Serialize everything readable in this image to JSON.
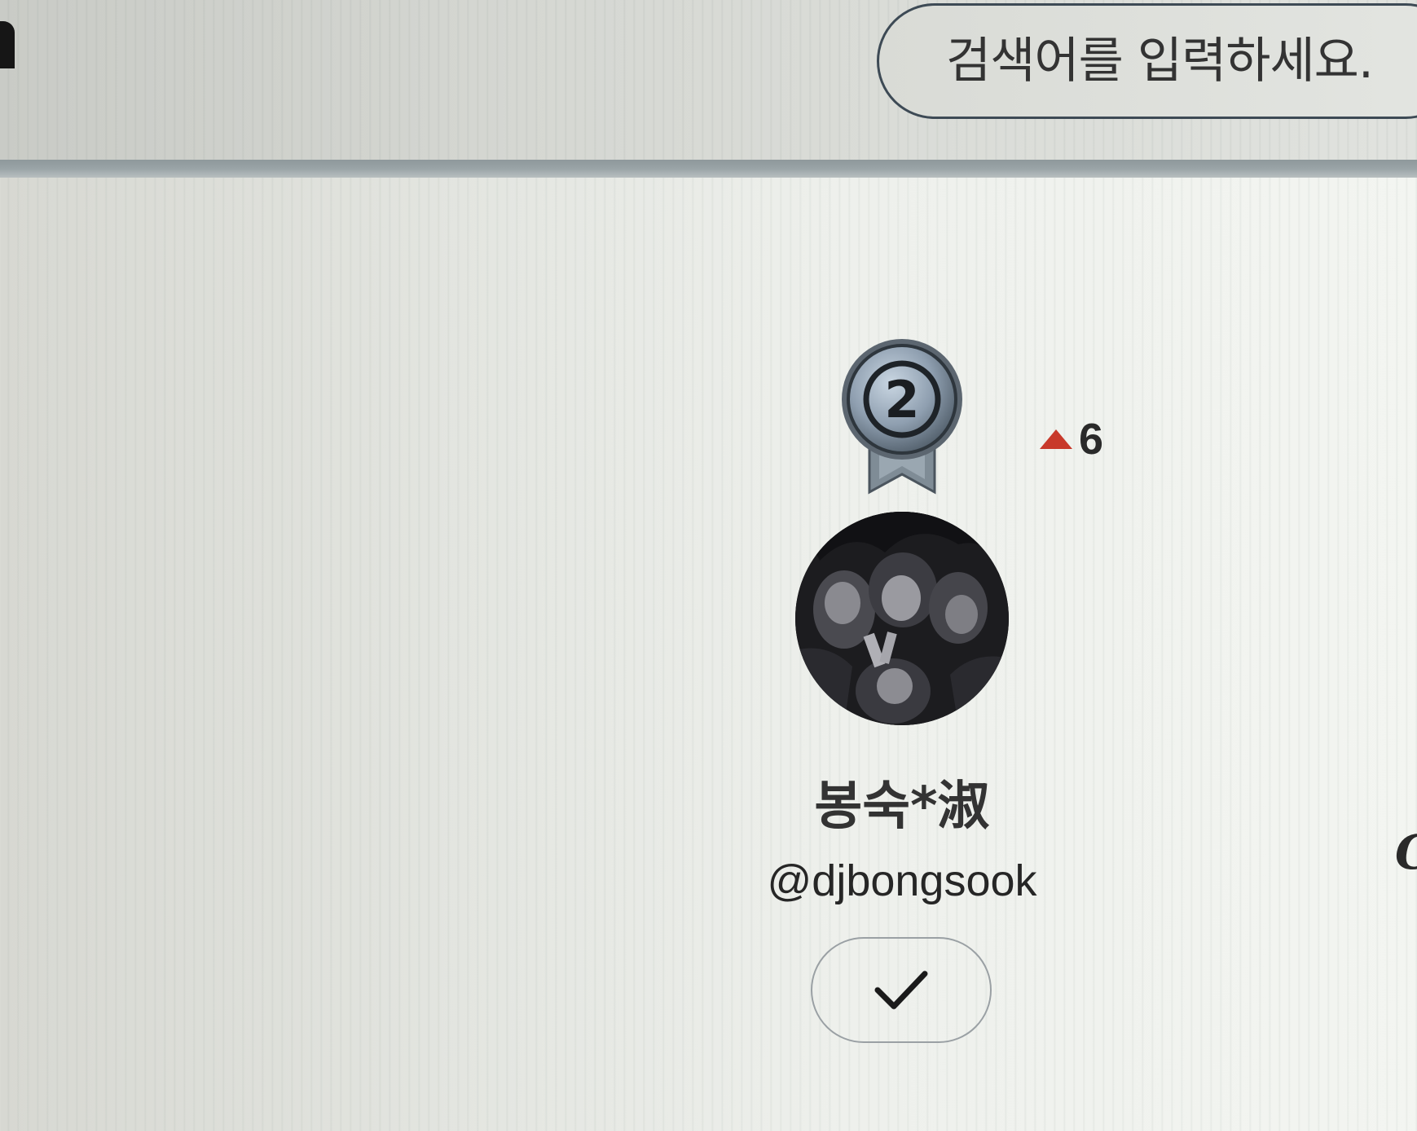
{
  "header": {
    "search": {
      "placeholder": "검색어를 입력하세요."
    }
  },
  "profile": {
    "rank": "2",
    "rank_change": "6",
    "rank_change_direction": "up",
    "display_name": "봉숙*淑",
    "handle": "@djbongsook",
    "follow_button_icon": "check-icon"
  },
  "edge_fragment": "C",
  "colors": {
    "rank_up": "#c8392b",
    "search_border": "#3d4a55",
    "divider": "#95a0a3",
    "badge_silver": "#8f9fb0"
  }
}
